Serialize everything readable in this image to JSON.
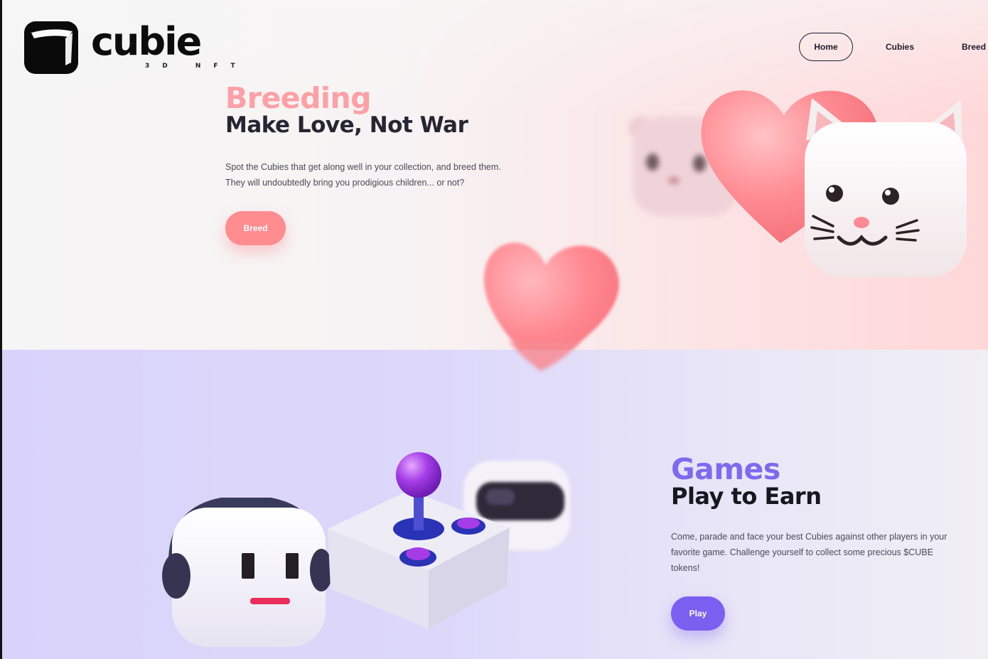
{
  "brand": {
    "name": "cubie",
    "tagline": "3D NFT"
  },
  "nav": {
    "items": [
      "Home",
      "Cubies",
      "Breed"
    ],
    "active": "Home"
  },
  "breeding": {
    "kicker": "Breeding",
    "headline": "Make Love, Not War",
    "description": "Spot the Cubies that get along well in your collection, and breed them. They will undoubtedly bring you prodigious children... or not?",
    "button_label": "Breed"
  },
  "games": {
    "kicker": "Games",
    "headline": "Play to Earn",
    "description": "Come, parade and face your best Cubies against other players in your favorite game. Challenge yourself to collect some precious $CUBE tokens!",
    "button_label": "Play"
  },
  "colors": {
    "breeding_accent": "#ffa0a6",
    "breeding_button": "#ff8c8f",
    "games_accent": "#7e69ef",
    "games_button": "#7a5ff1",
    "headline": "#262633"
  },
  "icons": [
    "cube-logo-icon",
    "heart-icon",
    "cat-cubie-icon",
    "bear-cubie-icon",
    "robot-cubie-icon",
    "joystick-icon",
    "vr-cubie-icon"
  ]
}
